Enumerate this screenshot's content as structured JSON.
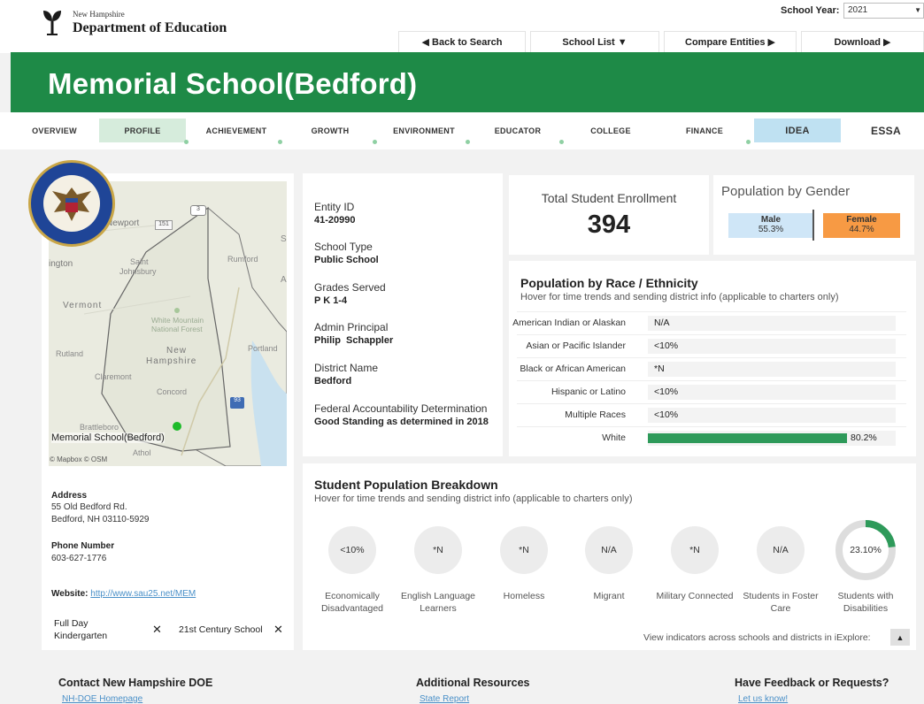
{
  "header": {
    "org_small": "New Hampshire",
    "org_big": "Department of Education",
    "school_year_label": "School Year:",
    "school_year_value": "2021"
  },
  "nav": {
    "back": "◀ Back to Search",
    "school_list": "School List ▼",
    "compare": "Compare Entities ▶",
    "download": "Download ▶"
  },
  "banner": {
    "title": "Memorial School(Bedford)"
  },
  "tabs": [
    "OVERVIEW",
    "PROFILE",
    "ACHIEVEMENT",
    "GROWTH",
    "ENVIRONMENT",
    "EDUCATOR",
    "COLLEGE",
    "FINANCE",
    "IDEA",
    "ESSA"
  ],
  "map": {
    "labels": {
      "newport": "Newport",
      "ington": "ington",
      "saint": "Saint",
      "johnsbury": "Johnsbury",
      "rumford": "Rumford",
      "vermont": "Vermont",
      "white": "White Mountain",
      "national": "National Forest",
      "rutland": "Rutland",
      "new": "New",
      "hampshire": "Hampshire",
      "portland": "Portland",
      "claremont": "Claremont",
      "concord": "Concord",
      "brattleboro": "Brattleboro",
      "athol": "Athol",
      "s": "S",
      "a": "A",
      "road3": "3",
      "road1": "151",
      "road93": "93"
    },
    "marker_label": "Memorial School(Bedford)",
    "attribution": "© Mapbox © OSM"
  },
  "address": {
    "label": "Address",
    "line1": "55 Old Bedford Rd.",
    "line2": "Bedford, NH 03110-5929",
    "phone_label": "Phone Number",
    "phone": "603-627-1776",
    "website_label": "Website:",
    "website": "http://www.sau25.net/MEM"
  },
  "features": {
    "full_day_1": "Full Day",
    "full_day_2": "Kindergarten",
    "century": "21st Century School",
    "x": "✕"
  },
  "entity": {
    "entity_id_label": "Entity ID",
    "entity_id": "41-20990",
    "school_type_label": "School Type",
    "school_type": "Public School",
    "grades_label": "Grades Served",
    "grades": "P K 1-4",
    "principal_label": "Admin Principal",
    "principal": "Philip  Schappler",
    "district_label": "District Name",
    "district": "Bedford",
    "federal_label": "Federal Accountability Determination",
    "federal": "Good Standing as determined in 2018"
  },
  "enrollment": {
    "title": "Total Student Enrollment",
    "value": "394"
  },
  "gender": {
    "title": "Population by Gender",
    "male_label": "Male",
    "male_pct": "55.3%",
    "female_label": "Female",
    "female_pct": "44.7%"
  },
  "race": {
    "title": "Population by Race / Ethnicity",
    "subtitle": "Hover for time trends and sending district info (applicable to charters only)",
    "rows": [
      {
        "label": "American Indian or Alaskan",
        "value": "N/A"
      },
      {
        "label": "Asian or Pacific Islander",
        "value": "<10%"
      },
      {
        "label": "Black or African American",
        "value": "*N"
      },
      {
        "label": "Hispanic or Latino",
        "value": "<10%"
      },
      {
        "label": "Multiple Races",
        "value": "<10%"
      },
      {
        "label": "White",
        "value": "80.2%",
        "bar_fraction": 0.802
      }
    ]
  },
  "breakdown": {
    "title": "Student Population Breakdown",
    "subtitle": "Hover for time trends and sending district info (applicable to charters only)",
    "items": [
      {
        "value": "<10%",
        "label1": "Economically",
        "label2": "Disadvantaged"
      },
      {
        "value": "*N",
        "label1": "English Language",
        "label2": "Learners"
      },
      {
        "value": "*N",
        "label1": "Homeless",
        "label2": ""
      },
      {
        "value": "N/A",
        "label1": "Migrant",
        "label2": ""
      },
      {
        "value": "*N",
        "label1": "Military Connected",
        "label2": ""
      },
      {
        "value": "N/A",
        "label1": "Students in Foster",
        "label2": "Care"
      },
      {
        "value": "23.10%",
        "label1": "Students with",
        "label2": "Disabilities",
        "fraction": 0.231
      }
    ],
    "iexplore": "View indicators across schools and districts in iExplore:",
    "iexplore_btn": "▲"
  },
  "footer": {
    "contact": "Contact New Hampshire DOE",
    "contact_link": "NH-DOE Homepage",
    "resources": "Additional Resources",
    "resources_link": "State Report",
    "feedback": "Have Feedback or Requests?",
    "feedback_link": "Let us know!"
  },
  "colors": {
    "brand_green": "#1e8a47",
    "bar_green": "#2e9a5a",
    "male": "#cfe6f7",
    "female": "#f79a44"
  }
}
